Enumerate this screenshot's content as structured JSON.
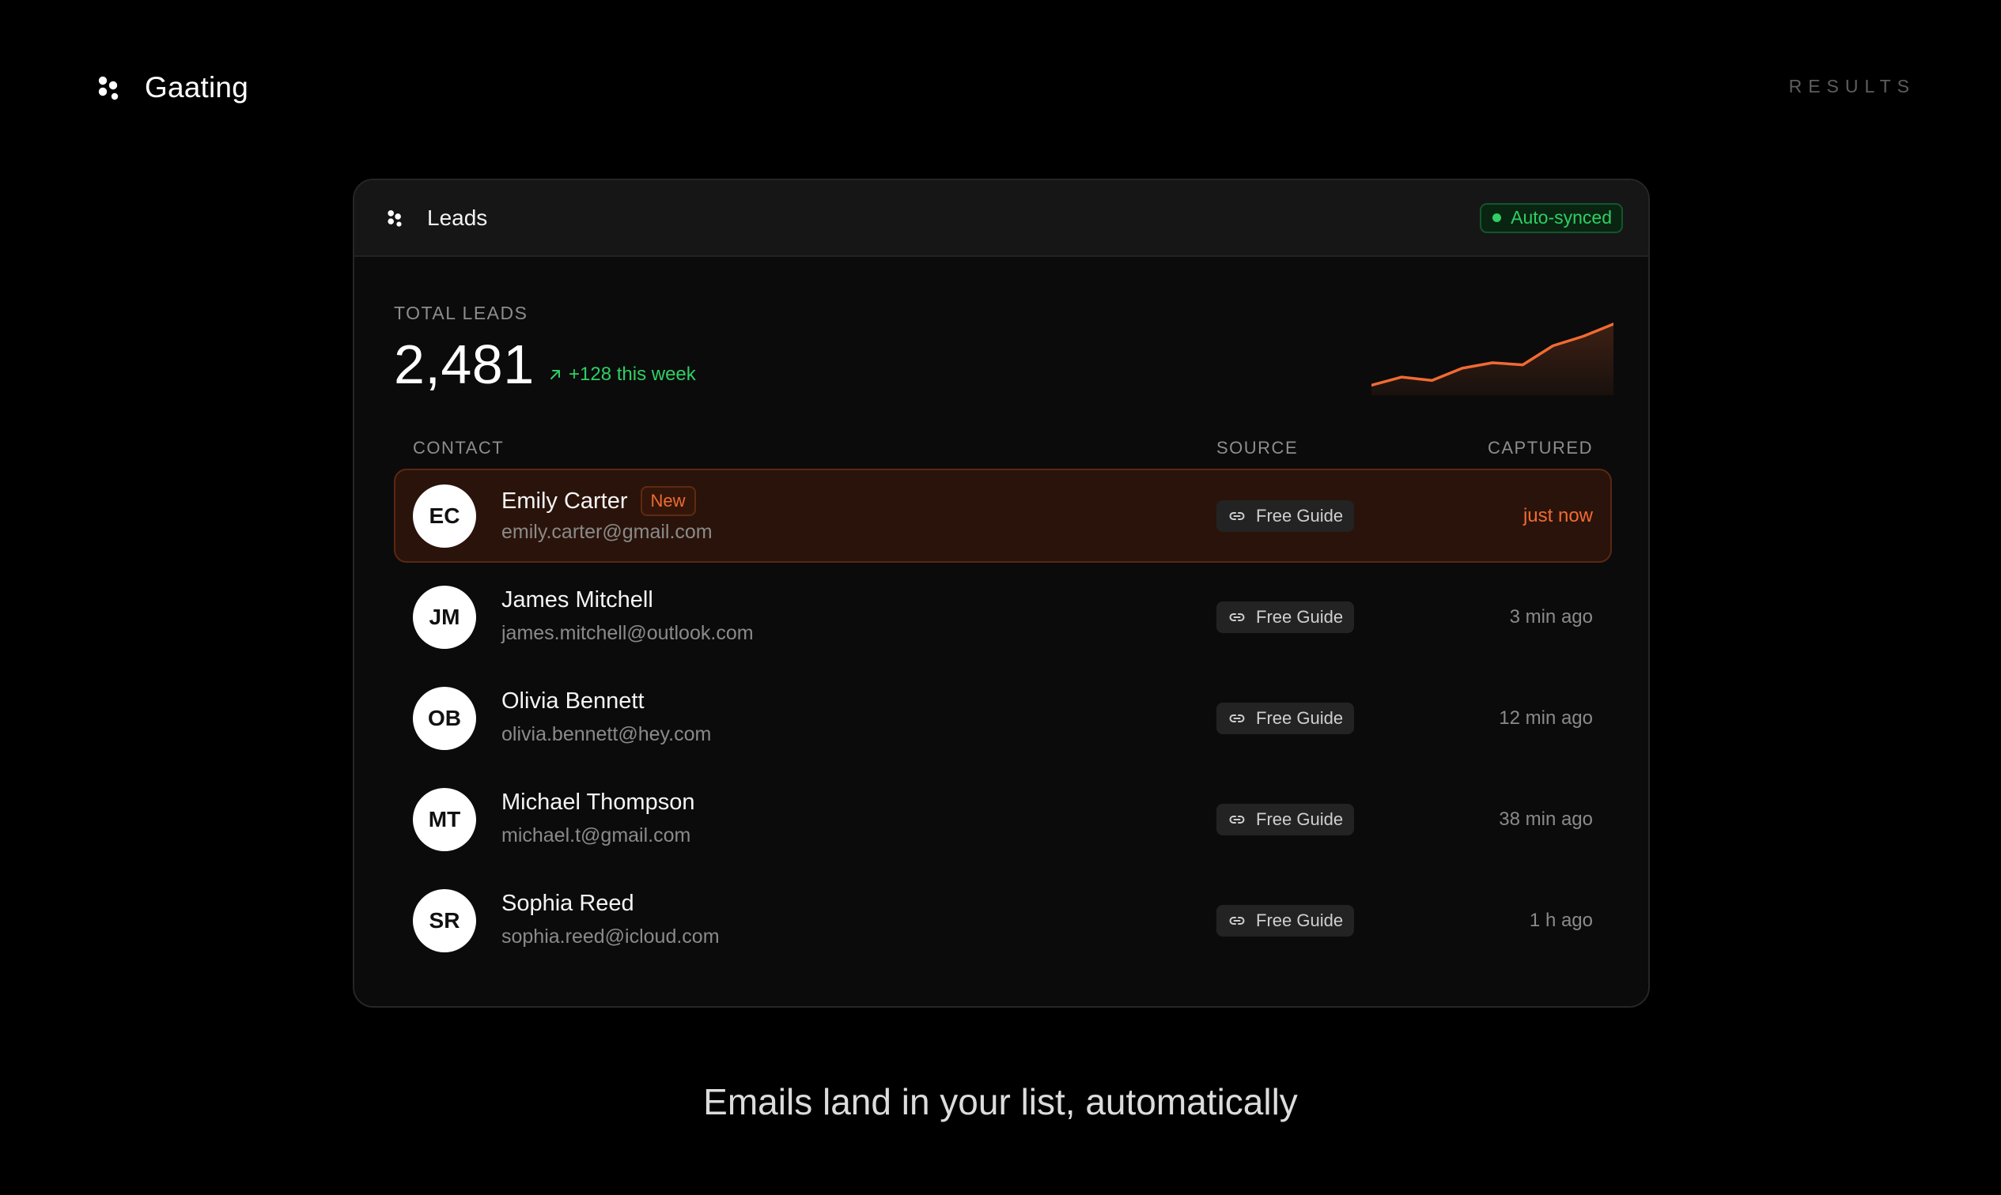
{
  "brand": {
    "name": "Gaating",
    "icon": "brand-dots-icon"
  },
  "nav": {
    "results_label": "RESULTS"
  },
  "card": {
    "title": "Leads",
    "status": "Auto-synced",
    "stats": {
      "label": "TOTAL LEADS",
      "total": "2,481",
      "delta": "+128 this week"
    },
    "sparkline": [
      0.1,
      0.22,
      0.17,
      0.35,
      0.43,
      0.4,
      0.68,
      0.82,
      1.0
    ],
    "columns": {
      "contact": "CONTACT",
      "source": "SOURCE",
      "captured": "CAPTURED"
    },
    "rows": [
      {
        "initials": "EC",
        "name": "Emily Carter",
        "badge": "New",
        "email": "emily.carter@gmail.com",
        "source": "Free Guide",
        "captured": "just now"
      },
      {
        "initials": "JM",
        "name": "James Mitchell",
        "badge": "",
        "email": "james.mitchell@outlook.com",
        "source": "Free Guide",
        "captured": "3 min ago"
      },
      {
        "initials": "OB",
        "name": "Olivia Bennett",
        "badge": "",
        "email": "olivia.bennett@hey.com",
        "source": "Free Guide",
        "captured": "12 min ago"
      },
      {
        "initials": "MT",
        "name": "Michael Thompson",
        "badge": "",
        "email": "michael.t@gmail.com",
        "source": "Free Guide",
        "captured": "38 min ago"
      },
      {
        "initials": "SR",
        "name": "Sophia Reed",
        "badge": "",
        "email": "sophia.reed@icloud.com",
        "source": "Free Guide",
        "captured": "1 h ago"
      }
    ]
  },
  "caption": "Emails land in your list, automatically",
  "colors": {
    "accent": "#f06b32",
    "success": "#2fcf63",
    "background": "#000000",
    "card": "#0b0b0b"
  }
}
